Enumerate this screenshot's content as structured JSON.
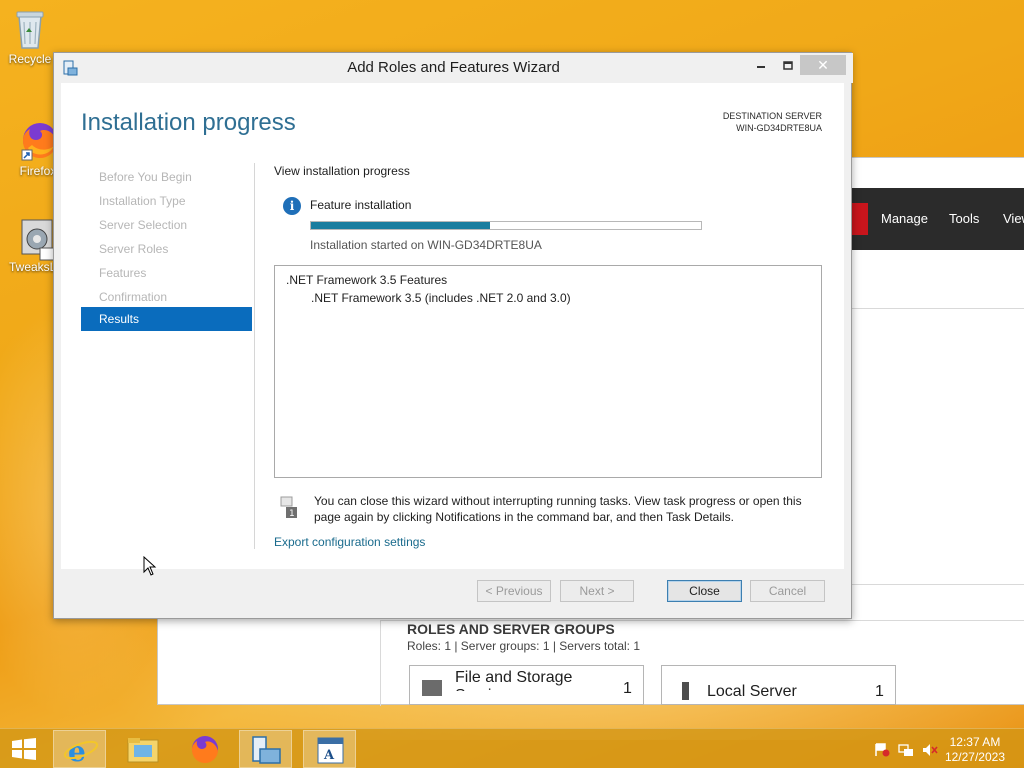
{
  "desktop": {
    "icons": [
      {
        "label": "Recycle",
        "icon": "recycle-bin-icon"
      },
      {
        "label": "Firefox",
        "icon": "firefox-icon"
      },
      {
        "label": "TweaksLo",
        "icon": "tweakslogon-icon"
      }
    ]
  },
  "server_manager": {
    "menu": [
      "Manage",
      "Tools",
      "View"
    ],
    "roles_title": "ROLES AND SERVER GROUPS",
    "roles_summary": "Roles: 1   |   Server groups: 1   |   Servers total: 1",
    "tiles": [
      {
        "name": "File and Storage Services",
        "count": "1",
        "icon": "file-storage-icon"
      },
      {
        "name": "Local Server",
        "count": "1",
        "icon": "server-icon"
      }
    ]
  },
  "wizard": {
    "title": "Add Roles and Features Wizard",
    "heading": "Installation progress",
    "destination_label": "DESTINATION SERVER",
    "destination_server": "WIN-GD34DRTE8UA",
    "nav": [
      {
        "label": "Before You Begin",
        "active": false
      },
      {
        "label": "Installation Type",
        "active": false
      },
      {
        "label": "Server Selection",
        "active": false
      },
      {
        "label": "Server Roles",
        "active": false
      },
      {
        "label": "Features",
        "active": false
      },
      {
        "label": "Confirmation",
        "active": false
      },
      {
        "label": "Results",
        "active": true
      }
    ],
    "section_label": "View installation progress",
    "feature_label": "Feature installation",
    "progress_fraction": 0.46,
    "started_text": "Installation started on WIN-GD34DRTE8UA",
    "results": {
      "item": ".NET Framework 3.5 Features",
      "subitem": ".NET Framework 3.5 (includes .NET 2.0 and 3.0)"
    },
    "note": "You can close this wizard without interrupting running tasks. View task progress or open this page again by clicking Notifications in the command bar, and then Task Details.",
    "export_link": "Export configuration settings",
    "buttons": {
      "previous": "< Previous",
      "next": "Next >",
      "close": "Close",
      "cancel": "Cancel"
    },
    "window_controls": {
      "minimize": "—",
      "maximize": "☐",
      "close": "✕"
    }
  },
  "taskbar": {
    "time": "12:37 AM",
    "date": "12/27/2023",
    "apps": [
      "internet-explorer-icon",
      "file-explorer-icon",
      "firefox-icon",
      "server-manager-icon",
      "wordpad-icon"
    ],
    "tray": [
      "action-center-flag-icon",
      "network-icon",
      "volume-muted-icon"
    ]
  },
  "colors": {
    "accent": "#0a6cbd",
    "heading": "#2f6f93",
    "progress": "#1a7d9f",
    "desktop": "#f0a818"
  }
}
